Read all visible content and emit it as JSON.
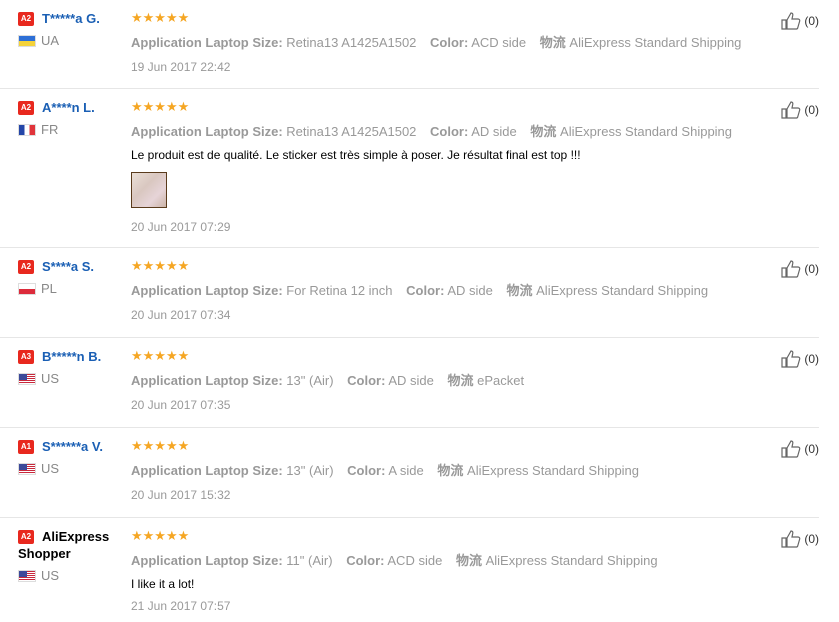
{
  "labels": {
    "size": "Application Laptop Size:",
    "color": "Color:",
    "shipping": "物流"
  },
  "reviews": [
    {
      "badge": "A2",
      "name": "T*****a G.",
      "country": "UA",
      "rating": 5,
      "size": "Retina13 A1425A1502",
      "color": "ACD side",
      "shipping": "AliExpress Standard Shipping",
      "text": "",
      "date": "19 Jun 2017 22:42",
      "likes": "(0)"
    },
    {
      "badge": "A2",
      "name": "A****n L.",
      "country": "FR",
      "rating": 5,
      "size": "Retina13 A1425A1502",
      "color": "AD side",
      "shipping": "AliExpress Standard Shipping",
      "text": "Le produit est de qualité. Le sticker est très simple à poser. Je résultat final est top !!!",
      "date": "20 Jun 2017 07:29",
      "likes": "(0)"
    },
    {
      "badge": "A2",
      "name": "S****a S.",
      "country": "PL",
      "rating": 5,
      "size": "For Retina 12 inch",
      "color": "AD side",
      "shipping": "AliExpress Standard Shipping",
      "text": "",
      "date": "20 Jun 2017 07:34",
      "likes": "(0)"
    },
    {
      "badge": "A3",
      "name": "B*****n B.",
      "country": "US",
      "rating": 5,
      "size": "13\" (Air)",
      "color": "AD side",
      "shipping": "ePacket",
      "text": "",
      "date": "20 Jun 2017 07:35",
      "likes": "(0)"
    },
    {
      "badge": "A1",
      "name": "S******a V.",
      "country": "US",
      "rating": 5,
      "size": "13\" (Air)",
      "color": "A side",
      "shipping": "AliExpress Standard Shipping",
      "text": "",
      "date": "20 Jun 2017 15:32",
      "likes": "(0)"
    },
    {
      "badge": "A2",
      "name": "AliExpress Shopper",
      "country": "US",
      "rating": 5,
      "size": "11\" (Air)",
      "color": "ACD side",
      "shipping": "AliExpress Standard Shipping",
      "text": "I like it a lot!",
      "date": "21 Jun 2017 07:57",
      "likes": "(0)"
    }
  ]
}
